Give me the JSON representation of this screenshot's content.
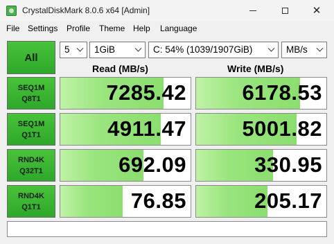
{
  "window": {
    "title": "CrystalDiskMark 8.0.6 x64 [Admin]"
  },
  "menu": {
    "items": [
      "File",
      "Settings",
      "Profile",
      "Theme",
      "Help",
      "Language"
    ]
  },
  "controls": {
    "all_label": "All",
    "count": "5",
    "size": "1GiB",
    "drive": "C: 54% (1039/1907GiB)",
    "unit": "MB/s"
  },
  "headers": {
    "read": "Read (MB/s)",
    "write": "Write (MB/s)"
  },
  "tests": [
    {
      "line1": "SEQ1M",
      "line2": "Q8T1",
      "read": "7285.42",
      "write": "6178.53",
      "read_fill": 0.79,
      "write_fill": 0.8
    },
    {
      "line1": "SEQ1M",
      "line2": "Q1T1",
      "read": "4911.47",
      "write": "5001.82",
      "read_fill": 0.77,
      "write_fill": 0.77
    },
    {
      "line1": "RND4K",
      "line2": "Q32T1",
      "read": "692.09",
      "write": "330.95",
      "read_fill": 0.64,
      "write_fill": 0.59
    },
    {
      "line1": "RND4K",
      "line2": "Q1T1",
      "read": "76.85",
      "write": "205.17",
      "read_fill": 0.48,
      "write_fill": 0.55
    }
  ],
  "status": {
    "text": ""
  },
  "colors": {
    "button_green": "#3cb534",
    "bar_green": "#9be57f"
  }
}
